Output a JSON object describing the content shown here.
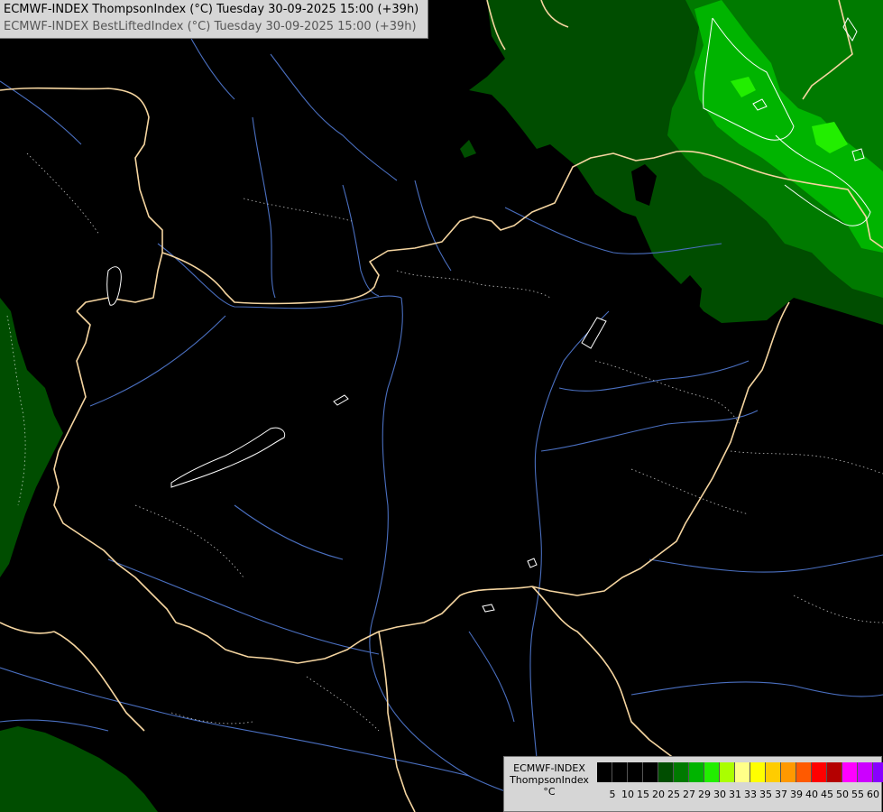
{
  "header": {
    "title_primary": "ECMWF-INDEX ThompsonIndex (°C) Tuesday 30-09-2025 15:00 (+39h)",
    "title_secondary": "ECMWF-INDEX BestLiftedIndex (°C) Tuesday 30-09-2025 15:00 (+39h)"
  },
  "legend": {
    "line1": "ECMWF-INDEX",
    "line2": "ThompsonIndex",
    "line3": "°C",
    "ticks": [
      "5",
      "10",
      "15",
      "20",
      "25",
      "27",
      "29",
      "30",
      "31",
      "33",
      "35",
      "37",
      "39",
      "40",
      "45",
      "50",
      "55",
      "60"
    ],
    "colors": [
      "#000000",
      "#000000",
      "#000000",
      "#000000",
      "#004d00",
      "#007a00",
      "#00b400",
      "#22ee00",
      "#aaff00",
      "#ffff88",
      "#ffff00",
      "#ffcc00",
      "#ff9900",
      "#ff5a00",
      "#ff0000",
      "#b40000",
      "#ff00ff",
      "#cc00ff",
      "#8800ff",
      "#4400ff",
      "#0000ff"
    ]
  },
  "map_colors": {
    "background": "#000000",
    "green_dark": "#004d00",
    "green_mid": "#007a00",
    "green_bright": "#00b400",
    "green_light": "#22ee00",
    "border": "#f5d5a0",
    "river": "#4a6fc0",
    "contour": "#ffffff"
  }
}
